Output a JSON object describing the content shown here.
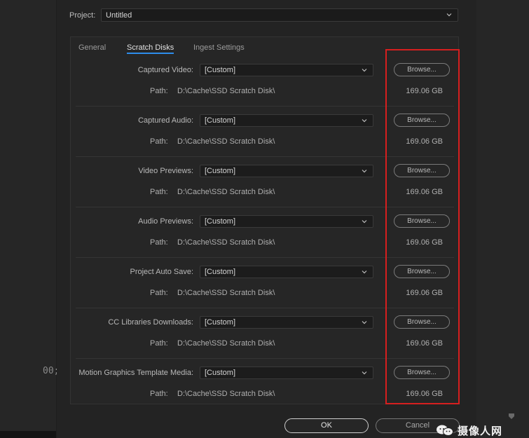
{
  "background": {
    "timecode": "00;"
  },
  "project": {
    "label": "Project:",
    "value": "Untitled"
  },
  "tabs": [
    {
      "label": "General",
      "active": false
    },
    {
      "label": "Scratch Disks",
      "active": true
    },
    {
      "label": "Ingest Settings",
      "active": false
    }
  ],
  "path_label": "Path:",
  "browse_label": "Browse...",
  "rows": [
    {
      "label": "Captured Video:",
      "value": "[Custom]",
      "path": "D:\\Cache\\SSD Scratch Disk\\",
      "size": "169.06 GB"
    },
    {
      "label": "Captured Audio:",
      "value": "[Custom]",
      "path": "D:\\Cache\\SSD Scratch Disk\\",
      "size": "169.06 GB"
    },
    {
      "label": "Video Previews:",
      "value": "[Custom]",
      "path": "D:\\Cache\\SSD Scratch Disk\\",
      "size": "169.06 GB"
    },
    {
      "label": "Audio Previews:",
      "value": "[Custom]",
      "path": "D:\\Cache\\SSD Scratch Disk\\",
      "size": "169.06 GB"
    },
    {
      "label": "Project Auto Save:",
      "value": "[Custom]",
      "path": "D:\\Cache\\SSD Scratch Disk\\",
      "size": "169.06 GB"
    },
    {
      "label": "CC Libraries Downloads:",
      "value": "[Custom]",
      "path": "D:\\Cache\\SSD Scratch Disk\\",
      "size": "169.06 GB"
    },
    {
      "label": "Motion Graphics Template Media:",
      "value": "[Custom]",
      "path": "D:\\Cache\\SSD Scratch Disk\\",
      "size": "169.06 GB"
    }
  ],
  "buttons": {
    "ok": "OK",
    "cancel": "Cancel"
  },
  "watermark": {
    "text": "摄像人网"
  },
  "colors": {
    "accent": "#2d8ceb",
    "highlight": "#d61f1f",
    "bg": "#232323"
  }
}
